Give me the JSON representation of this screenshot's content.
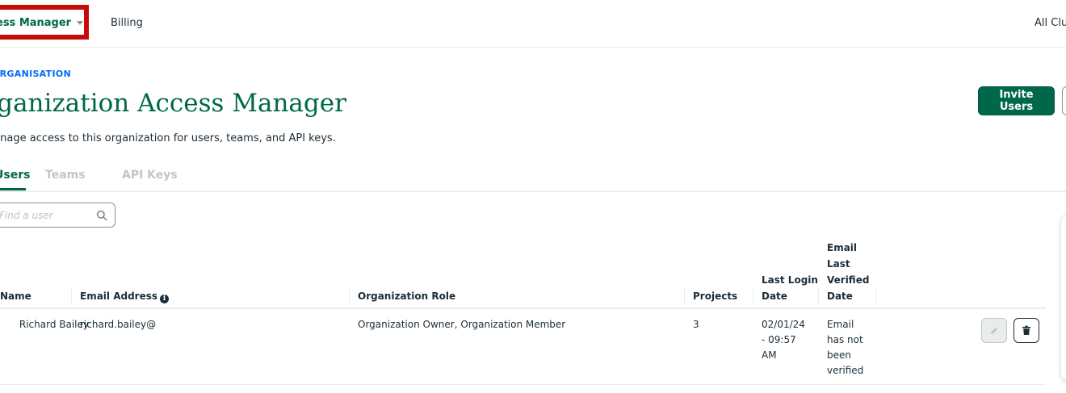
{
  "nav": {
    "access_manager": "ess Manager",
    "billing": "Billing",
    "all_clusters": "All Clu"
  },
  "header": {
    "org_label": "ORGANISATION",
    "title": "Organization Access Manager",
    "description": "Manage access to this organization for users, teams, and API keys.",
    "invite_button": "Invite Users"
  },
  "tabs": [
    {
      "label": "Users",
      "active": true
    },
    {
      "label": "Teams",
      "active": false
    },
    {
      "label": "API Keys",
      "active": false
    }
  ],
  "search": {
    "placeholder": "Find a user"
  },
  "table": {
    "columns": {
      "name": "Name",
      "email": "Email Address",
      "role": "Organization Role",
      "projects": "Projects",
      "last_login": "Last Login Date",
      "email_verified": "Email Last Verified Date"
    },
    "rows": [
      {
        "name": "Richard Bailey",
        "email": "richard.bailey@",
        "role": "Organization Owner, Organization Member",
        "projects": "3",
        "last_login": "02/01/24 - 09:57 AM",
        "email_verified": "Email has not been verified"
      }
    ]
  },
  "icons": {
    "search": "search-icon",
    "info": "info-icon",
    "edit": "pencil-icon",
    "delete": "trash-icon",
    "caret": "caret-down-icon"
  },
  "colors": {
    "brand_green": "#00684a",
    "org_blue": "#016bf8",
    "highlight_red": "#c80a0a",
    "text": "#1c2d38"
  }
}
